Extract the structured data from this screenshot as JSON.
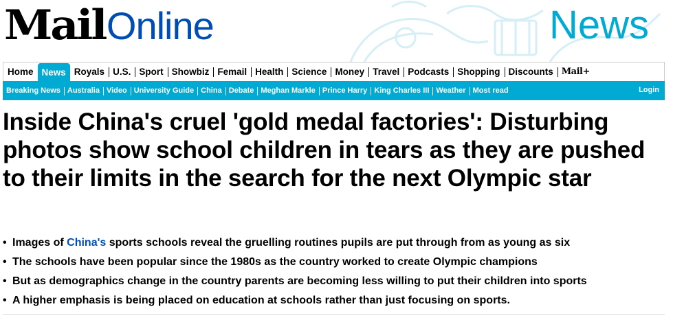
{
  "masthead": {
    "logo_mail": "Mail",
    "logo_online": "Online",
    "channel": "News"
  },
  "nav_primary": {
    "items": [
      {
        "label": "Home"
      },
      {
        "label": "News",
        "active": true
      },
      {
        "label": "Royals"
      },
      {
        "label": "U.S."
      },
      {
        "label": "Sport"
      },
      {
        "label": "Showbiz"
      },
      {
        "label": "Femail"
      },
      {
        "label": "Health"
      },
      {
        "label": "Science"
      },
      {
        "label": "Money"
      },
      {
        "label": "Travel"
      },
      {
        "label": "Podcasts"
      },
      {
        "label": "Shopping"
      },
      {
        "label": "Discounts"
      },
      {
        "label": "Mail+"
      }
    ]
  },
  "nav_secondary": {
    "items": [
      {
        "label": "Breaking News"
      },
      {
        "label": "Australia"
      },
      {
        "label": "Video"
      },
      {
        "label": "University Guide"
      },
      {
        "label": "China"
      },
      {
        "label": "Debate"
      },
      {
        "label": "Meghan Markle"
      },
      {
        "label": "Prince Harry"
      },
      {
        "label": "King Charles III"
      },
      {
        "label": "Weather"
      },
      {
        "label": "Most read"
      }
    ],
    "login": "Login"
  },
  "article": {
    "headline": "Inside China's cruel 'gold medal factories': Disturbing photos show school children in tears as they are pushed to their limits in the search for the next Olympic star",
    "bullets": [
      {
        "before": "Images of ",
        "link": "China's",
        "after": " sports schools reveal the gruelling routines pupils are put through from as young as six"
      },
      {
        "before": "The schools have been popular since the 1980s as the country worked to create Olympic champions",
        "link": "",
        "after": ""
      },
      {
        "before": "But as demographics change in the country parents are becoming less willing to put their children into sports",
        "link": "",
        "after": ""
      },
      {
        "before": "A higher emphasis is being placed on education at schools rather than just focusing on sports.",
        "link": "",
        "after": ""
      }
    ]
  },
  "colors": {
    "brand_blue": "#004db3",
    "channel_cyan": "#00aad2",
    "text": "#000000"
  }
}
